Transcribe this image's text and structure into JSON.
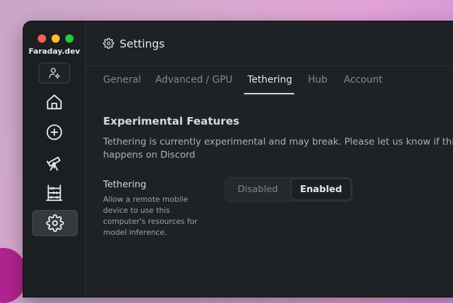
{
  "window": {
    "app_title": "Faraday.dev"
  },
  "sidebar": {
    "items": [
      {
        "name": "home",
        "icon": "home-icon"
      },
      {
        "name": "add-model",
        "icon": "plus-circle-icon"
      },
      {
        "name": "explore",
        "icon": "telescope-icon"
      },
      {
        "name": "compute",
        "icon": "abacus-icon"
      },
      {
        "name": "settings",
        "icon": "gear-icon",
        "active": true
      }
    ]
  },
  "header": {
    "title": "Settings"
  },
  "tabs": [
    {
      "label": "General"
    },
    {
      "label": "Advanced / GPU"
    },
    {
      "label": "Tethering",
      "active": true
    },
    {
      "label": "Hub"
    },
    {
      "label": "Account"
    }
  ],
  "section": {
    "title": "Experimental Features",
    "description": "Tethering is currently experimental and may break. Please let us know if this happens on Discord",
    "setting_label": "Tethering",
    "setting_help": "Allow a remote mobile device to use this computer's resources for model inference.",
    "toggle": {
      "options": [
        "Disabled",
        "Enabled"
      ],
      "selected": "Enabled"
    }
  }
}
